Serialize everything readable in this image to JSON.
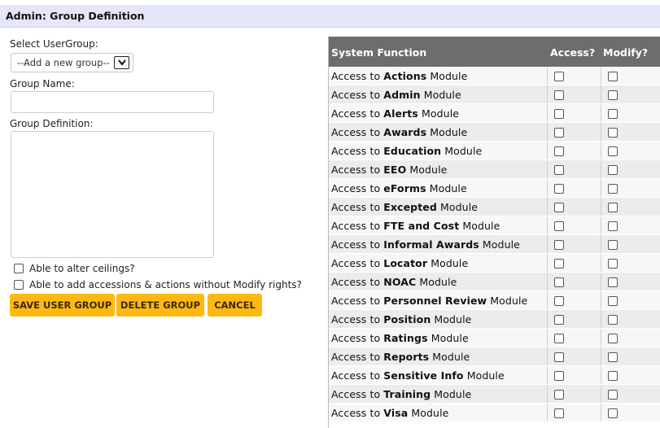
{
  "header": {
    "title": "Admin: Group Definition"
  },
  "form": {
    "select_usergroup_label": "Select UserGroup:",
    "select_usergroup_value": "--Add a new group--",
    "group_name_label": "Group Name:",
    "group_name_value": "",
    "group_definition_label": "Group Definition:",
    "group_definition_value": "",
    "options": [
      {
        "label": "Able to alter ceilings?",
        "checked": false
      },
      {
        "label": "Able to add accessions & actions without Modify rights?",
        "checked": false
      }
    ],
    "buttons": {
      "save": "SAVE USER GROUP",
      "delete": "DELETE GROUP",
      "cancel": "CANCEL"
    },
    "accent_color": "#fdb913"
  },
  "table": {
    "headers": {
      "function": "System Function",
      "access": "Access?",
      "modify": "Modify?"
    },
    "header_color": "#6d6d6d",
    "rows": [
      {
        "prefix": "Access to",
        "name": "Actions",
        "suffix": "Module",
        "access": false,
        "modify": false
      },
      {
        "prefix": "Access to",
        "name": "Admin",
        "suffix": "Module",
        "access": false,
        "modify": false
      },
      {
        "prefix": "Access to",
        "name": "Alerts",
        "suffix": "Module",
        "access": false,
        "modify": false
      },
      {
        "prefix": "Access to",
        "name": "Awards",
        "suffix": "Module",
        "access": false,
        "modify": false
      },
      {
        "prefix": "Access to",
        "name": "Education",
        "suffix": "Module",
        "access": false,
        "modify": false
      },
      {
        "prefix": "Access to",
        "name": "EEO",
        "suffix": "Module",
        "access": false,
        "modify": false
      },
      {
        "prefix": "Access to",
        "name": "eForms",
        "suffix": "Module",
        "access": false,
        "modify": false
      },
      {
        "prefix": "Access to",
        "name": "Excepted",
        "suffix": "Module",
        "access": false,
        "modify": false
      },
      {
        "prefix": "Access to",
        "name": "FTE and Cost",
        "suffix": "Module",
        "access": false,
        "modify": false
      },
      {
        "prefix": "Access to",
        "name": "Informal Awards",
        "suffix": "Module",
        "access": false,
        "modify": false
      },
      {
        "prefix": "Access to",
        "name": "Locator",
        "suffix": "Module",
        "access": false,
        "modify": false
      },
      {
        "prefix": "Access to",
        "name": "NOAC",
        "suffix": "Module",
        "access": false,
        "modify": false
      },
      {
        "prefix": "Access to",
        "name": "Personnel Review",
        "suffix": "Module",
        "access": false,
        "modify": false
      },
      {
        "prefix": "Access to",
        "name": "Position",
        "suffix": "Module",
        "access": false,
        "modify": false
      },
      {
        "prefix": "Access to",
        "name": "Ratings",
        "suffix": "Module",
        "access": false,
        "modify": false
      },
      {
        "prefix": "Access to",
        "name": "Reports",
        "suffix": "Module",
        "access": false,
        "modify": false
      },
      {
        "prefix": "Access to",
        "name": "Sensitive Info",
        "suffix": "Module",
        "access": false,
        "modify": false
      },
      {
        "prefix": "Access to",
        "name": "Training",
        "suffix": "Module",
        "access": false,
        "modify": false
      },
      {
        "prefix": "Access to",
        "name": "Visa",
        "suffix": "Module",
        "access": false,
        "modify": false
      }
    ]
  }
}
